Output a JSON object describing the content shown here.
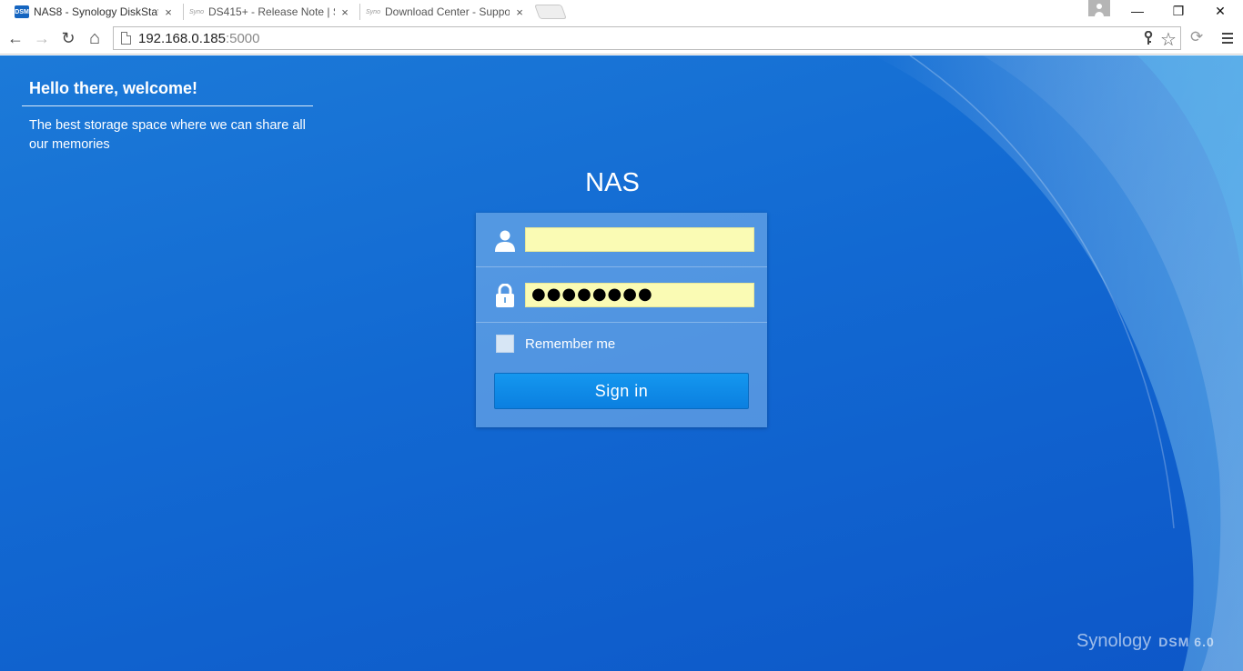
{
  "browser": {
    "tabs": [
      {
        "favicon": "DSM",
        "title": "NAS8 - Synology DiskStat",
        "close": "×",
        "active": true
      },
      {
        "favicon": "Syno",
        "title": "DS415+ - Release Note | S",
        "close": "×",
        "active": false
      },
      {
        "favicon": "Syno",
        "title": "Download Center - Suppo",
        "close": "×",
        "active": false
      }
    ],
    "window": {
      "minimize": "—",
      "restore": "❐",
      "close": "✕"
    },
    "nav": {
      "back": "←",
      "forward": "→",
      "reload": "↻",
      "home": "⌂"
    },
    "address": {
      "host": "192.168.0.185",
      "port": ":5000"
    },
    "omnibox_icons": {
      "key": "key-icon",
      "star": "☆",
      "extension": "⟳"
    }
  },
  "page": {
    "welcome_title": "Hello there, welcome!",
    "welcome_subtitle": "The best storage space where we can share all our memories",
    "server_name": "NAS",
    "login": {
      "username_value": "",
      "password_value": "●●●●●●●●",
      "remember_label": "Remember me",
      "remember_checked": false,
      "signin_label": "Sign in"
    },
    "brand": {
      "name": "Synology",
      "product": "DSM 6.0"
    }
  },
  "colors": {
    "background": "#1269d2",
    "input_fill": "#fafbb4",
    "button": "#0b7fe0"
  }
}
